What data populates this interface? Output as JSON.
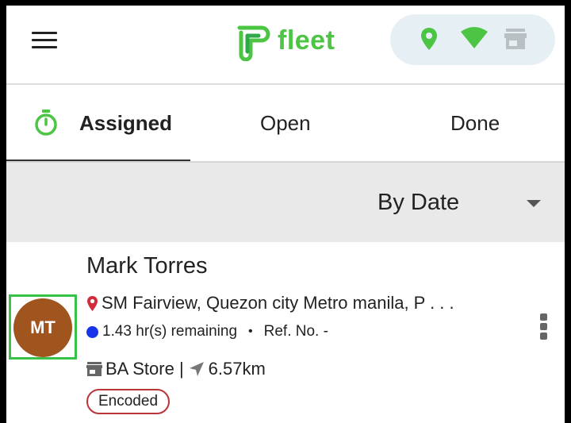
{
  "header": {
    "logo_text": "fleet",
    "status": {
      "location": "location-pin-icon",
      "signal": "wifi-icon",
      "store": "store-icon"
    }
  },
  "tabs": [
    {
      "label": "Assigned",
      "active": true,
      "icon": "timer-icon"
    },
    {
      "label": "Open",
      "active": false
    },
    {
      "label": "Done",
      "active": false
    }
  ],
  "filter": {
    "selected": "By Date"
  },
  "card": {
    "avatar_initials": "MT",
    "name": "Mark Torres",
    "address": "SM Fairview, Quezon city Metro manila, P . . .",
    "time_remaining": "1.43 hr(s) remaining",
    "ref_no": "Ref. No. -",
    "store": "BA Store |",
    "distance": "6.57km",
    "status_badge": "Encoded"
  },
  "colors": {
    "brand_green": "#4cc544",
    "avatar_bg": "#a0541e",
    "badge_border": "#b9353a",
    "pin_red": "#d22b3a",
    "dot_blue": "#1734e8"
  }
}
